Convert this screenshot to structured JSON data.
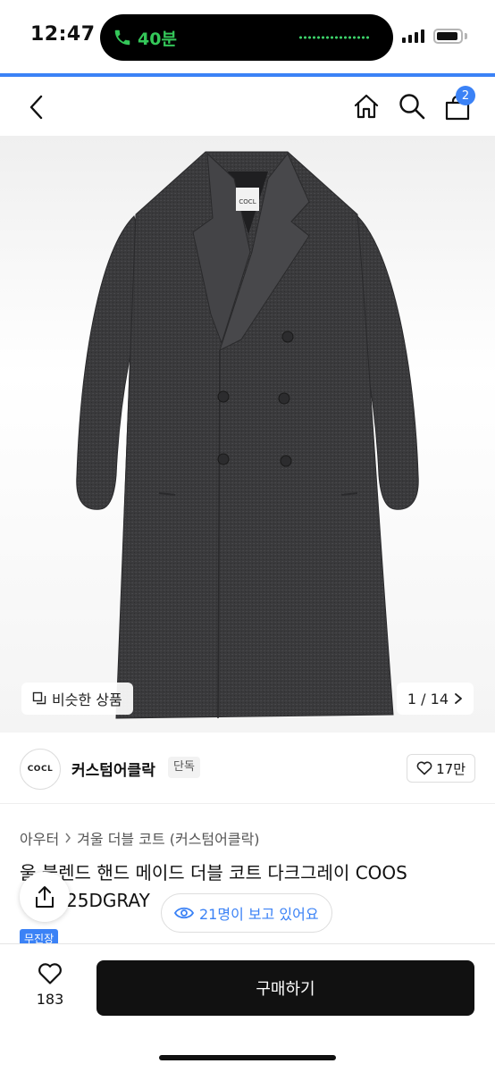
{
  "status": {
    "time": "12:47",
    "call_label": "40분",
    "battery_level": 0.92
  },
  "nav": {
    "back_icon": "chevron-left-icon",
    "home_icon": "home-icon",
    "search_icon": "search-icon",
    "cart_icon": "cart-icon",
    "cart_count": "2"
  },
  "gallery": {
    "brand_tag": "COCL",
    "similar_label": "비슷한 상품",
    "pager": "1 / 14"
  },
  "seller": {
    "logo_text": "COCL",
    "name": "커스텀어클락",
    "tag": "단독",
    "likes": "17만"
  },
  "product": {
    "breadcrumb": [
      "아우터",
      "겨울 더블 코트 (커스텀어클락)"
    ],
    "title_line1": "울 블렌드 핸드 메이드 더블 코트 다크그레이 COOS",
    "title_line2": "25DGRAY",
    "new_badge": "무진장",
    "viewers": "21명이 보고 있어요"
  },
  "actions": {
    "wish_count": "183",
    "buy_label": "구매하기"
  },
  "colors": {
    "accent": "#3b82f6",
    "buy": "#111111",
    "coat": "#3b3b3d"
  }
}
